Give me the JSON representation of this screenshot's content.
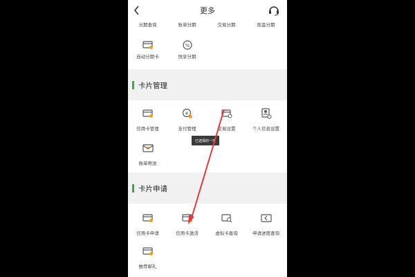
{
  "header": {
    "title": "更多"
  },
  "top_row": [
    {
      "label": "分期查询"
    },
    {
      "label": "账单分期"
    },
    {
      "label": "交易分期"
    },
    {
      "label": "现金分期"
    }
  ],
  "top_extra": [
    {
      "label": "自动分期卡",
      "icon": "auto-installment-card-icon"
    },
    {
      "label": "悦享分期",
      "icon": "yuexiang-installment-icon"
    }
  ],
  "card_management": {
    "title": "卡片管理",
    "items": [
      {
        "label": "信用卡管理",
        "icon": "credit-card-manage-icon"
      },
      {
        "label": "支付管理",
        "icon": "payment-manage-icon"
      },
      {
        "label": "交易设置",
        "icon": "transaction-settings-icon"
      },
      {
        "label": "个人信息设置",
        "icon": "personal-info-icon"
      },
      {
        "label": "账单寄送",
        "icon": "bill-mail-icon"
      }
    ]
  },
  "card_application": {
    "title": "卡片申请",
    "items": [
      {
        "label": "信用卡申请",
        "icon": "credit-card-apply-icon"
      },
      {
        "label": "信用卡激活",
        "icon": "credit-card-activate-icon"
      },
      {
        "label": "虚拟卡查询",
        "icon": "virtual-card-query-icon"
      },
      {
        "label": "申请进度查询",
        "icon": "application-progress-icon"
      },
      {
        "label": "推荐邮礼",
        "icon": "recommend-gift-icon"
      }
    ]
  },
  "tooltip": {
    "text": "已选择的一项"
  },
  "colors": {
    "accent": "#2fb04a",
    "arrow": "#e23b3b",
    "icon": "#555555",
    "icon_accent": "#f0a020"
  }
}
